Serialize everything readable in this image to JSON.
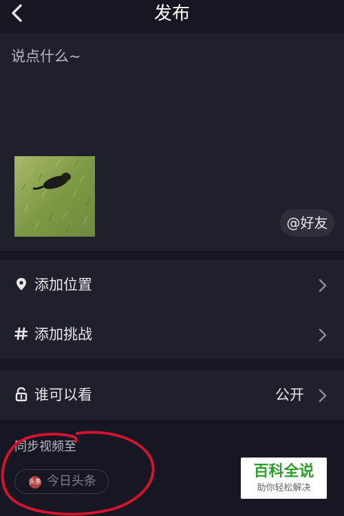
{
  "header": {
    "title": "发布"
  },
  "compose": {
    "caption_placeholder": "说点什么~",
    "mention_label": "@好友"
  },
  "options": {
    "location_label": "添加位置",
    "challenge_label": "添加挑战",
    "visibility_label": "谁可以看",
    "visibility_value": "公开"
  },
  "sync": {
    "title": "同步视频至",
    "platform_label": "今日头条",
    "platform_icon_text": "头条"
  },
  "watermark": {
    "title": "百科全说",
    "subtitle": "助你轻松解决"
  },
  "icons": {
    "back": "chevron-left-icon",
    "location": "location-pin-icon",
    "challenge": "hashtag-icon",
    "visibility": "unlock-icon",
    "chevron": "chevron-right-icon"
  },
  "colors": {
    "background": "#161723",
    "panel": "#1e202c",
    "text": "#e8e8ea",
    "muted": "#b9bac2",
    "annotation": "#d3142e",
    "watermark_green": "#2c9f2c"
  }
}
